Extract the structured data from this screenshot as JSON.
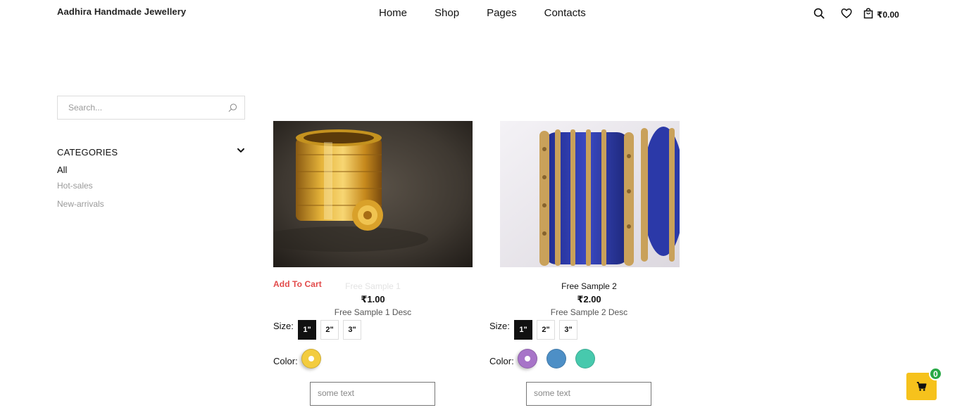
{
  "header": {
    "brand": "Aadhira Handmade Jewellery",
    "nav": [
      "Home",
      "Shop",
      "Pages",
      "Contacts"
    ],
    "cart_total": "₹0.00"
  },
  "sidebar": {
    "search_placeholder": "Search...",
    "categories_title": "CATEGORIES",
    "categories": [
      "All",
      "Hot-sales",
      "New-arrivals"
    ],
    "active_category": "All"
  },
  "products": [
    {
      "name": "Free Sample 1",
      "price": "₹1.00",
      "desc": "Free Sample 1 Desc",
      "add_to_cart": "Add To Cart",
      "size_label": "Size:",
      "sizes": [
        "1\"",
        "2\"",
        "3\""
      ],
      "selected_size": "1\"",
      "color_label": "Color:",
      "colors": [
        "#f3cc3f"
      ],
      "selected_color": "#f3cc3f",
      "text_placeholder": "some text"
    },
    {
      "name": "Free Sample 2",
      "price": "₹2.00",
      "desc": "Free Sample 2 Desc",
      "size_label": "Size:",
      "sizes": [
        "1\"",
        "2\"",
        "3\""
      ],
      "selected_size": "1\"",
      "color_label": "Color:",
      "colors": [
        "#a774c8",
        "#4d8fc6",
        "#47c9ad"
      ],
      "selected_color": "#a774c8",
      "text_placeholder": "some text"
    }
  ],
  "floating_cart": {
    "count": "0",
    "color": "#f6c21c",
    "badge_color": "#27a845"
  }
}
